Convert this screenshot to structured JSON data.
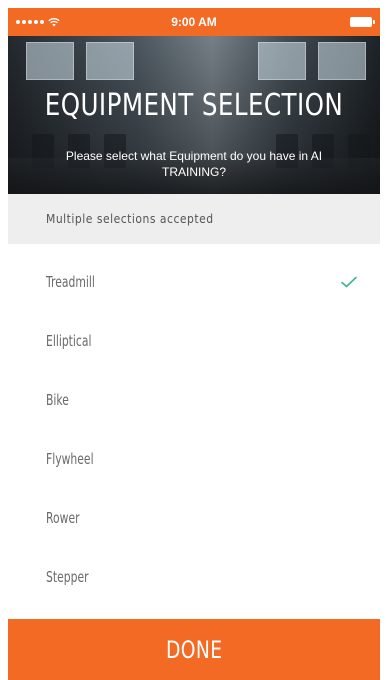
{
  "status_bar": {
    "time": "9:00 AM",
    "signal_icon": "signal-dots-icon",
    "wifi_icon": "wifi-icon",
    "battery_icon": "battery-icon"
  },
  "header": {
    "title": "EQUIPMENT SELECTION",
    "subtitle": "Please select what Equipment do you have in AI TRAINING?"
  },
  "note": "Multiple selections accepted",
  "options": [
    {
      "label": "Treadmill",
      "selected": true
    },
    {
      "label": "Elliptical",
      "selected": false
    },
    {
      "label": "Bike",
      "selected": false
    },
    {
      "label": "Flywheel",
      "selected": false
    },
    {
      "label": "Rower",
      "selected": false
    },
    {
      "label": "Stepper",
      "selected": false
    }
  ],
  "footer": {
    "done_label": "DONE"
  },
  "colors": {
    "accent": "#f26a23",
    "check": "#3fb58d",
    "note_bg": "#eeeeef",
    "option_text": "#6a6a6a"
  }
}
